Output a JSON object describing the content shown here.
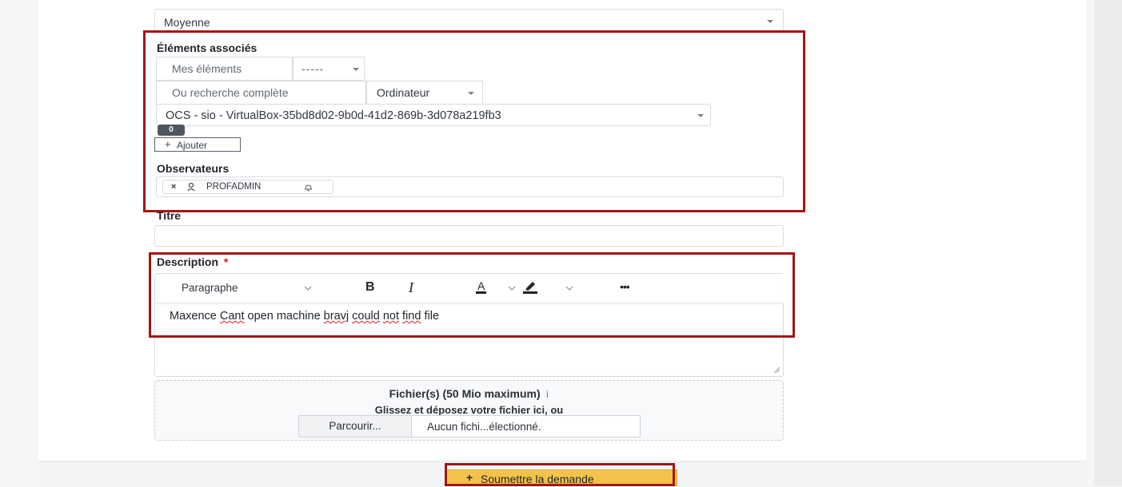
{
  "urgency": {
    "value": "Moyenne"
  },
  "linked_items": {
    "label": "Éléments associés",
    "my_items_label": "Mes éléments",
    "my_items_select": "-----",
    "full_search_label": "Ou recherche complète",
    "type_select": "Ordinateur",
    "item_select": "OCS - sio - VirtualBox-35bd8d02-9b0d-41d2-869b-3d078a219fb3",
    "count_badge": "0",
    "add_button": "Ajouter"
  },
  "observers": {
    "label": "Observateurs",
    "chip_label": "PROFADMIN"
  },
  "title": {
    "label": "Titre",
    "value": ""
  },
  "description": {
    "label": "Description",
    "required_mark": "*",
    "toolbar": {
      "paragraph_select": "Paragraphe",
      "bold": "B",
      "italic": "I",
      "font_color": "A",
      "more": "•••"
    },
    "text_parts": [
      "Maxence ",
      "Cant",
      " open machine ",
      "bravj",
      " ",
      "could",
      " ",
      "not",
      " ",
      "find",
      " file"
    ]
  },
  "files": {
    "title": "Fichier(s) (50 Mio maximum)",
    "info": "i",
    "drop_hint": "Glissez et déposez votre fichier ici, ou",
    "browse": "Parcourir...",
    "none_selected": "Aucun fichi...électionné."
  },
  "submit": {
    "label": "Soumettre la demande"
  },
  "icons": [
    "caret-down-icon",
    "user-icon",
    "bell-icon",
    "close-icon",
    "plus-icon",
    "bold-icon",
    "italic-icon",
    "font-color-icon",
    "highlight-icon",
    "more-icon",
    "info-icon",
    "resize-handle-icon"
  ],
  "colors": {
    "highlight_outline": "#a31515",
    "submit_bg": "#f3c24a",
    "required": "#d21f1f"
  }
}
